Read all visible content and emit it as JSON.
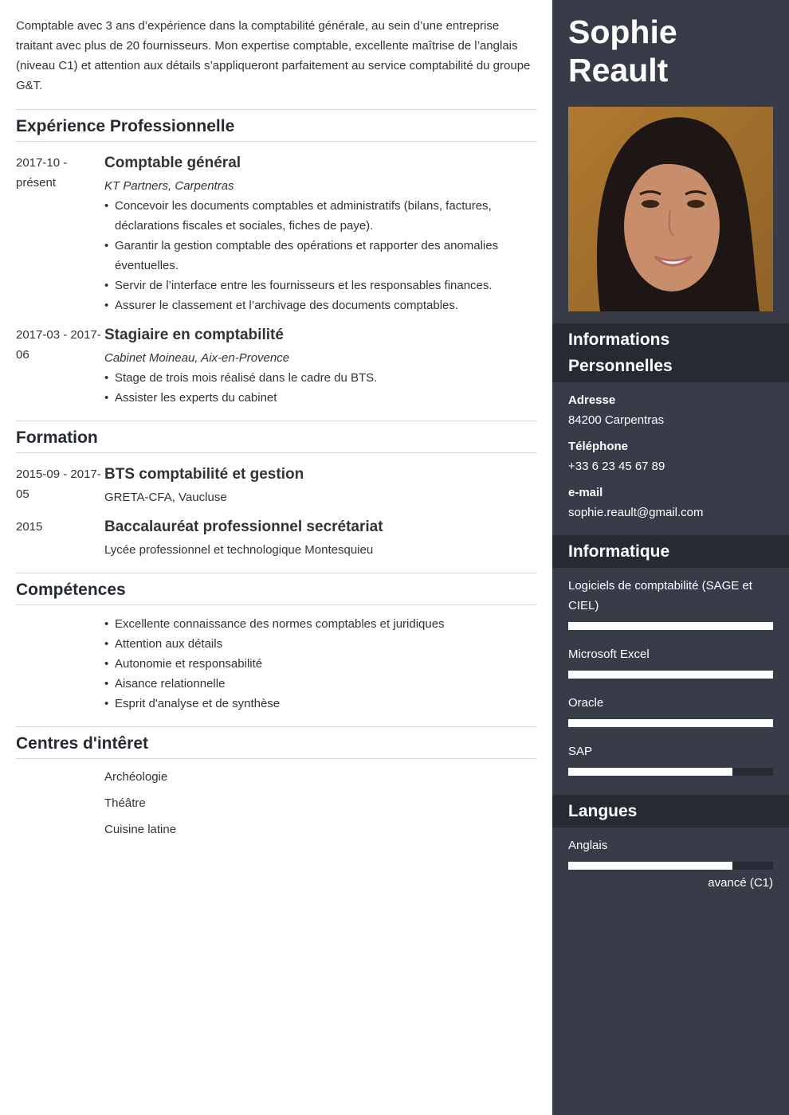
{
  "summary": "Comptable avec 3 ans d’expérience dans la comptabilité générale, au sein d’une entreprise traitant avec plus de 20 fournisseurs. Mon expertise comptable, excellente maîtrise de l’anglais (niveau C1) et attention aux détails s’appliqueront parfaitement au service comptabilité du groupe G&T.",
  "experience": {
    "title": "Expérience Professionnelle",
    "entries": [
      {
        "date": "2017-10 - présent",
        "title": "Comptable général",
        "company": "KT Partners, Carpentras",
        "bullets": [
          "Concevoir les documents comptables et administratifs (bilans, factures, déclarations fiscales et sociales, fiches de paye).",
          "Garantir la gestion comptable des opérations et rapporter des anomalies éventuelles.",
          "Servir de l’interface entre les fournisseurs et les responsables finances.",
          "Assurer le classement et l’archivage des documents comptables."
        ]
      },
      {
        "date": "2017-03 - 2017-06",
        "title": "Stagiaire en comptabilité",
        "company": "Cabinet Moineau, Aix-en-Provence",
        "bullets": [
          "Stage de trois mois réalisé dans le cadre du BTS.",
          "Assister les experts du cabinet"
        ]
      }
    ]
  },
  "education": {
    "title": "Formation",
    "entries": [
      {
        "date": "2015-09 - 2017-05",
        "title": "BTS comptabilité et gestion",
        "school": "GRETA-CFA, Vaucluse"
      },
      {
        "date": "2015",
        "title": "Baccalauréat professionnel secrétariat",
        "school": "Lycée professionnel et technologique Montesquieu"
      }
    ]
  },
  "skills": {
    "title": "Compétences",
    "items": [
      "Excellente connaissance des normes comptables et juridiques",
      "Attention aux détails",
      "Autonomie et responsabilité",
      "Aisance relationnelle",
      "Esprit d'analyse et de synthèse"
    ]
  },
  "interests": {
    "title": "Centres d'intêret",
    "items": [
      "Archéologie",
      "Théâtre",
      "Cuisine latine"
    ]
  },
  "sidebar": {
    "first_name": "Sophie",
    "last_name": "Reault",
    "photo_alt": "profile-photo",
    "personal": {
      "title": "Informations Personnelles",
      "address_label": "Adresse",
      "address": "84200 Carpentras",
      "phone_label": "Téléphone",
      "phone": "+33 6 23 45 67 89",
      "email_label": "e-mail",
      "email": "sophie.reault@gmail.com"
    },
    "it": {
      "title": "Informatique",
      "items": [
        {
          "name": "Logiciels de comptabilité (SAGE et CIEL)",
          "level": 1.0
        },
        {
          "name": "Microsoft Excel",
          "level": 1.0
        },
        {
          "name": "Oracle",
          "level": 1.0
        },
        {
          "name": "SAP",
          "level": 0.8
        }
      ]
    },
    "languages": {
      "title": "Langues",
      "items": [
        {
          "name": "Anglais",
          "level": 0.8,
          "level_label": "avancé (C1)"
        }
      ]
    }
  },
  "colors": {
    "sidebar_bg": "#373c48",
    "sidebar_head_bg": "#262a33",
    "heading_text": "#262b33",
    "body_text": "#333333"
  }
}
